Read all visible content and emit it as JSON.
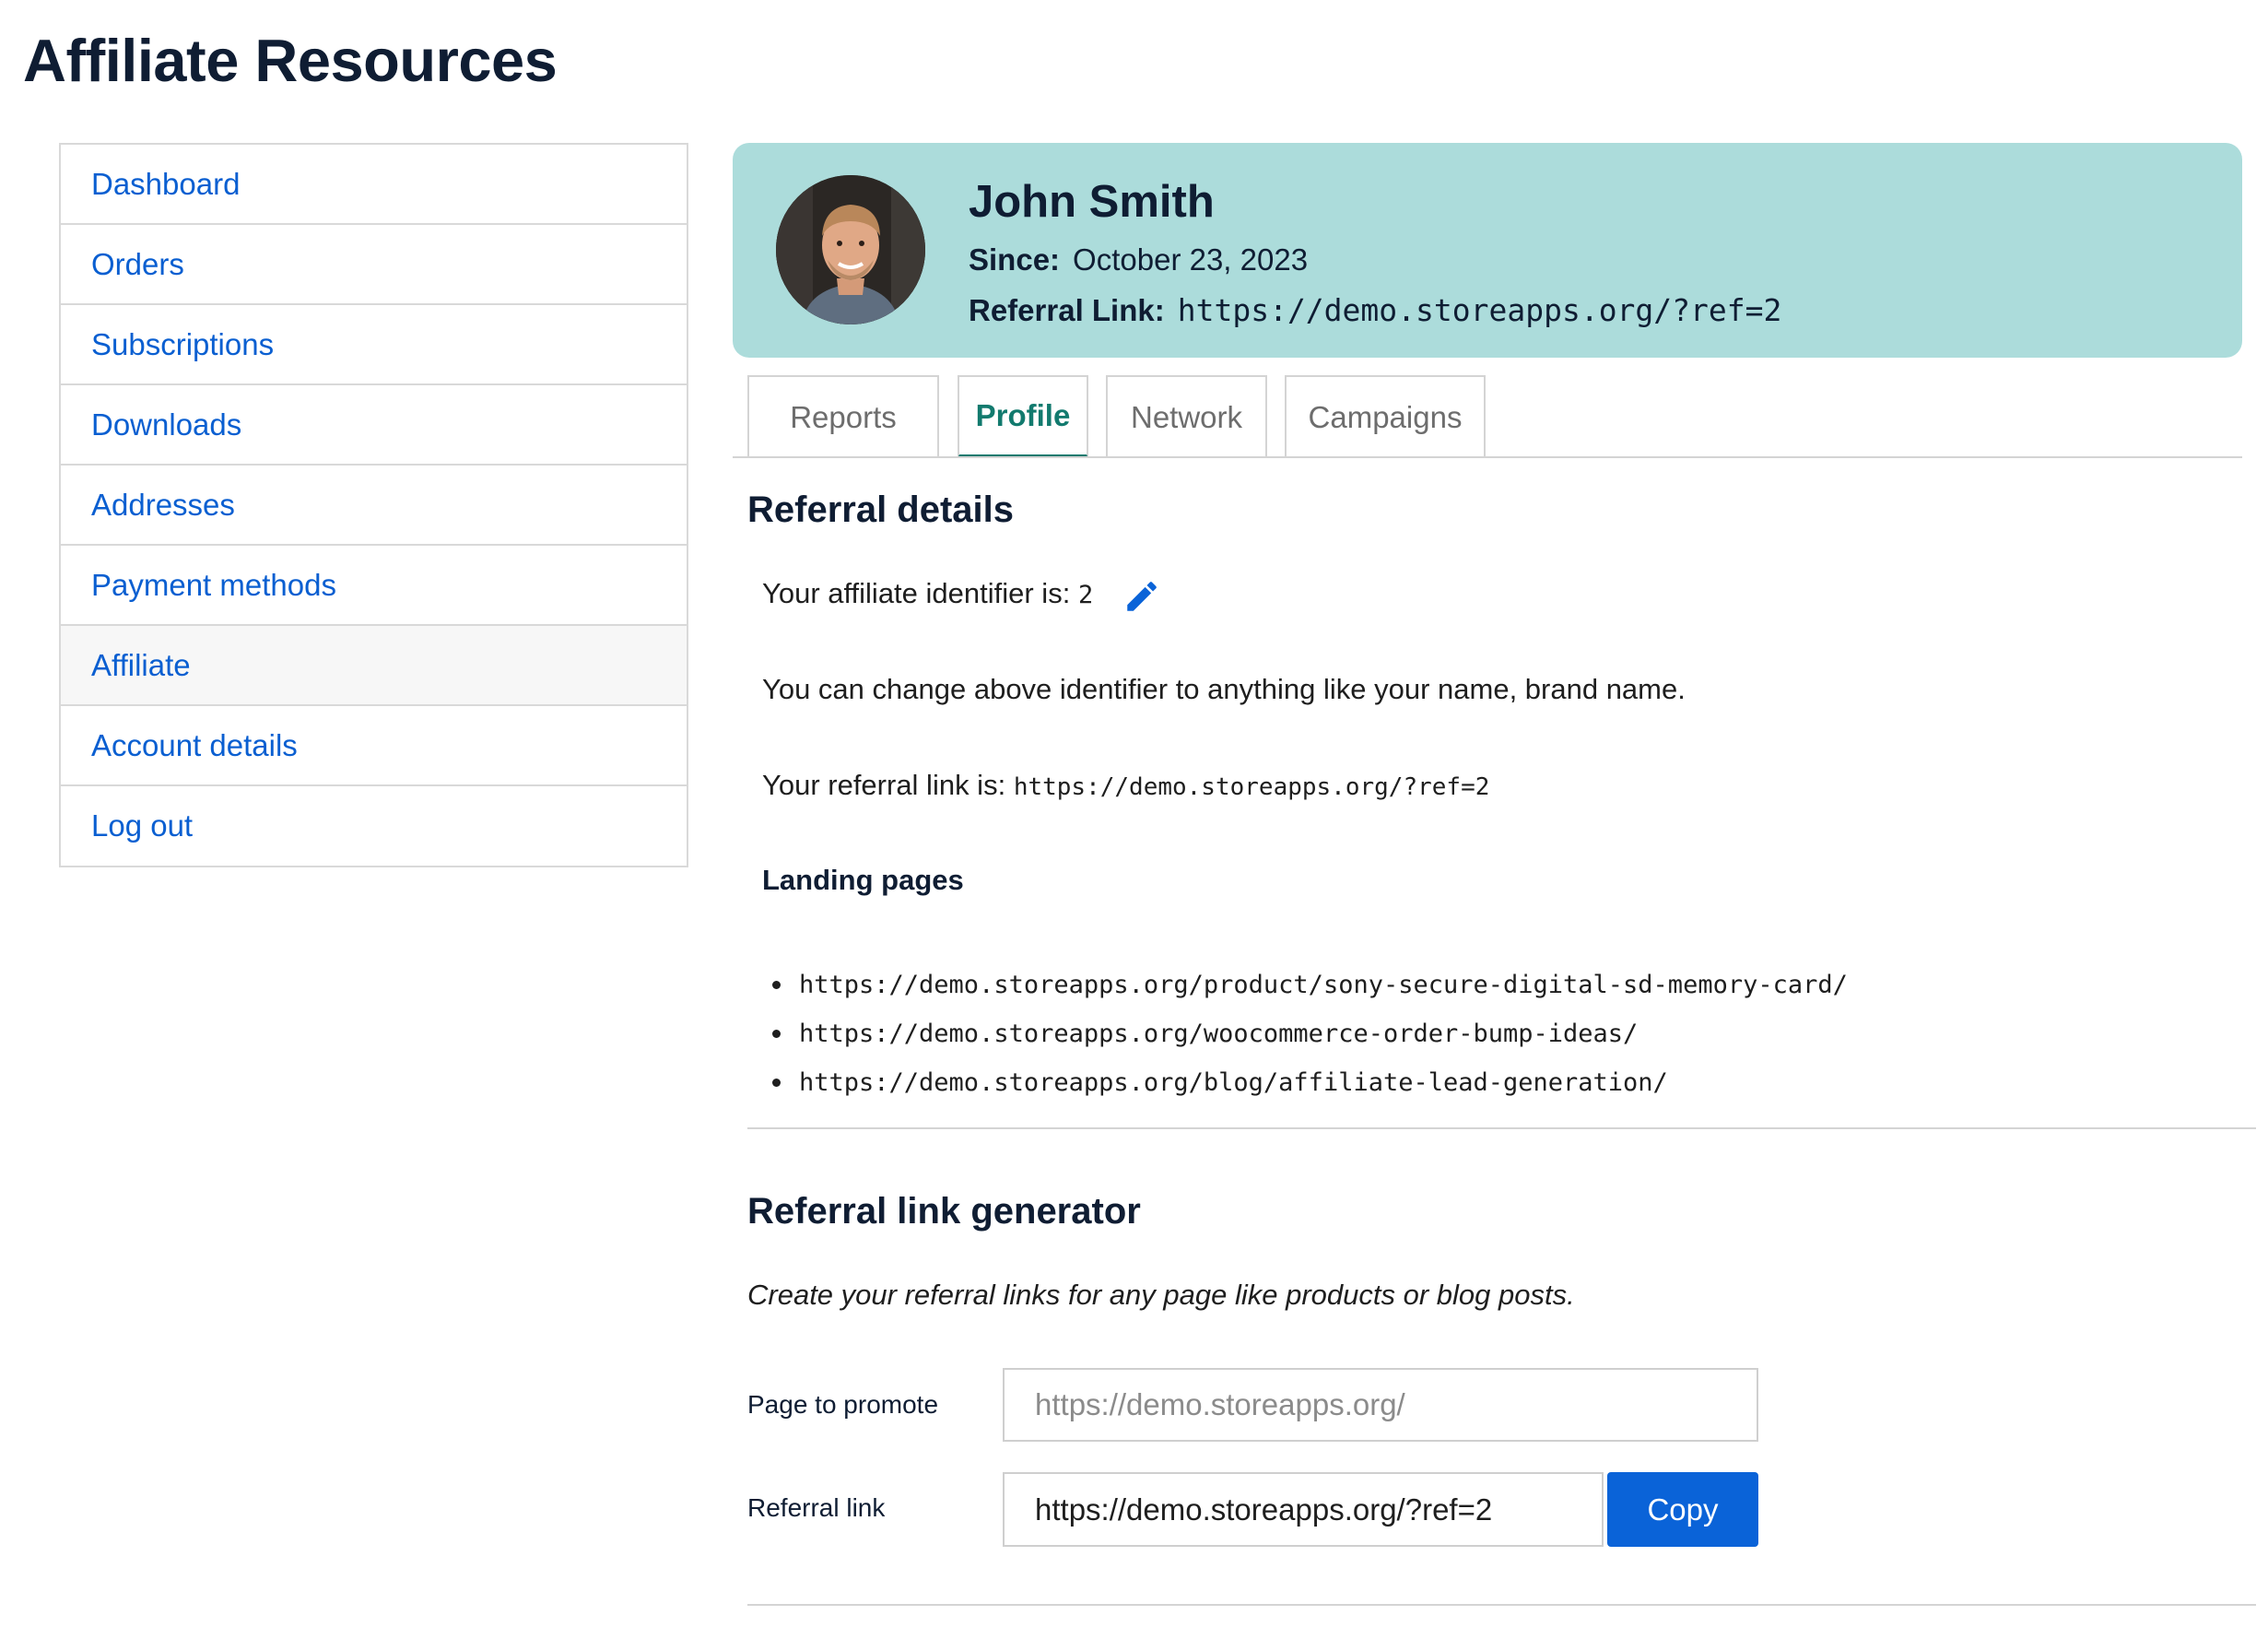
{
  "page_title": "Affiliate Resources",
  "sidebar": {
    "items": [
      {
        "label": "Dashboard"
      },
      {
        "label": "Orders"
      },
      {
        "label": "Subscriptions"
      },
      {
        "label": "Downloads"
      },
      {
        "label": "Addresses"
      },
      {
        "label": "Payment methods"
      },
      {
        "label": "Affiliate"
      },
      {
        "label": "Account details"
      },
      {
        "label": "Log out"
      }
    ],
    "active": "Affiliate"
  },
  "profile": {
    "name": "John Smith",
    "since_label": "Since:",
    "since_value": "October 23, 2023",
    "link_label": "Referral Link:",
    "link_value": "https://demo.storeapps.org/?ref=2",
    "card_color": "#acdcdb"
  },
  "tabs": [
    {
      "label": "Reports"
    },
    {
      "label": "Profile"
    },
    {
      "label": "Network"
    },
    {
      "label": "Campaigns"
    }
  ],
  "active_tab": "Profile",
  "referral_details": {
    "title": "Referral details",
    "identifier_text": "Your affiliate identifier is:",
    "identifier_value": "2",
    "edit_icon": "pencil-icon",
    "change_hint": "You can change above identifier to anything like your name, brand name.",
    "link_text": "Your referral link is:",
    "link_value": "https://demo.storeapps.org/?ref=2",
    "landing_title": "Landing pages",
    "landing_pages": [
      "https://demo.storeapps.org/product/sony-secure-digital-sd-memory-card/",
      "https://demo.storeapps.org/woocommerce-order-bump-ideas/",
      "https://demo.storeapps.org/blog/affiliate-lead-generation/"
    ]
  },
  "generator": {
    "title": "Referral link generator",
    "subtitle": "Create your referral links for any page like products or blog posts.",
    "page_label": "Page to promote",
    "page_placeholder": "https://demo.storeapps.org/",
    "link_label": "Referral link",
    "link_value": "https://demo.storeapps.org/?ref=2",
    "copy_label": "Copy"
  },
  "colors": {
    "link": "#0a5fd1",
    "accent_tab": "#127a6e",
    "button": "#0a63d8"
  }
}
